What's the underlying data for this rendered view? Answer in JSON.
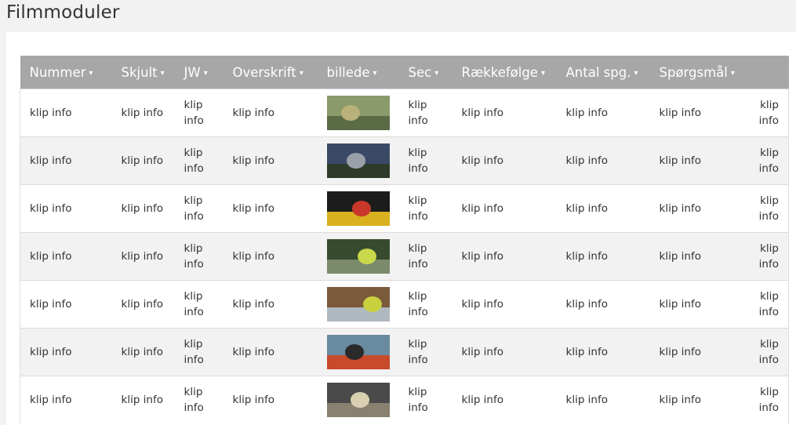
{
  "page": {
    "title": "Filmmoduler"
  },
  "table": {
    "columns": [
      {
        "label": "Nummer"
      },
      {
        "label": "Skjult"
      },
      {
        "label": "JW"
      },
      {
        "label": "Overskrift"
      },
      {
        "label": "billede"
      },
      {
        "label": "Sec"
      },
      {
        "label": "Rækkefølge"
      },
      {
        "label": "Antal spg."
      },
      {
        "label": "Spørgsmål"
      },
      {
        "label": ""
      }
    ],
    "caret": "▾",
    "cell_text": "klip info",
    "rows": [
      {
        "thumb": "landscape-scene",
        "colors": [
          "#8b9a6a",
          "#b9b07a",
          "#5a6b45"
        ]
      },
      {
        "thumb": "car-roadside-scene",
        "colors": [
          "#3a4a66",
          "#9aa0a8",
          "#2f3a2a"
        ]
      },
      {
        "thumb": "worker-red-suit-scene",
        "colors": [
          "#1c1c1c",
          "#c8372a",
          "#d8b020"
        ]
      },
      {
        "thumb": "workers-hivis-scene",
        "colors": [
          "#364a2e",
          "#c9d84a",
          "#7a8a6a"
        ]
      },
      {
        "thumb": "indoor-workers-scene",
        "colors": [
          "#7a5a3a",
          "#c8d040",
          "#b0b8c0"
        ]
      },
      {
        "thumb": "construction-site-scene",
        "colors": [
          "#6a8aa0",
          "#2a2a2a",
          "#c84a2a"
        ]
      },
      {
        "thumb": "truck-tunnel-scene",
        "colors": [
          "#4a4a4a",
          "#d8d0b0",
          "#8a8070"
        ]
      }
    ]
  }
}
